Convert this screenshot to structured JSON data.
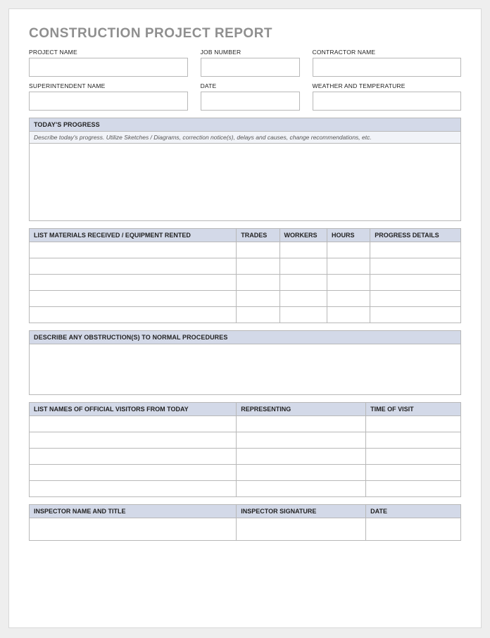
{
  "title": "CONSTRUCTION PROJECT REPORT",
  "header": {
    "row1": {
      "project_name_label": "PROJECT NAME",
      "job_number_label": "JOB NUMBER",
      "contractor_name_label": "CONTRACTOR NAME",
      "project_name_value": "",
      "job_number_value": "",
      "contractor_name_value": ""
    },
    "row2": {
      "superintendent_name_label": "SUPERINTENDENT NAME",
      "date_label": "DATE",
      "weather_label": "WEATHER AND TEMPERATURE",
      "superintendent_name_value": "",
      "date_value": "",
      "weather_value": ""
    }
  },
  "progress": {
    "header": "TODAY'S PROGRESS",
    "subheader": "Describe today's progress.  Utilize Sketches / Diagrams, correction notice(s), delays and causes, change recommendations, etc.",
    "body": ""
  },
  "materials": {
    "columns": {
      "c1": "LIST MATERIALS RECEIVED / EQUIPMENT RENTED",
      "c2": "TRADES",
      "c3": "WORKERS",
      "c4": "HOURS",
      "c5": "PROGRESS DETAILS"
    },
    "rows": [
      {
        "c1": "",
        "c2": "",
        "c3": "",
        "c4": "",
        "c5": ""
      },
      {
        "c1": "",
        "c2": "",
        "c3": "",
        "c4": "",
        "c5": ""
      },
      {
        "c1": "",
        "c2": "",
        "c3": "",
        "c4": "",
        "c5": ""
      },
      {
        "c1": "",
        "c2": "",
        "c3": "",
        "c4": "",
        "c5": ""
      },
      {
        "c1": "",
        "c2": "",
        "c3": "",
        "c4": "",
        "c5": ""
      }
    ]
  },
  "obstructions": {
    "header": "DESCRIBE ANY OBSTRUCTION(S) TO NORMAL PROCEDURES",
    "body": ""
  },
  "visitors": {
    "columns": {
      "c1": "LIST NAMES OF OFFICIAL VISITORS FROM TODAY",
      "c2": "REPRESENTING",
      "c3": "TIME OF VISIT"
    },
    "rows": [
      {
        "c1": "",
        "c2": "",
        "c3": ""
      },
      {
        "c1": "",
        "c2": "",
        "c3": ""
      },
      {
        "c1": "",
        "c2": "",
        "c3": ""
      },
      {
        "c1": "",
        "c2": "",
        "c3": ""
      },
      {
        "c1": "",
        "c2": "",
        "c3": ""
      }
    ]
  },
  "inspector": {
    "columns": {
      "c1": "INSPECTOR NAME AND TITLE",
      "c2": "INSPECTOR SIGNATURE",
      "c3": "DATE"
    },
    "row": {
      "c1": "",
      "c2": "",
      "c3": ""
    }
  }
}
